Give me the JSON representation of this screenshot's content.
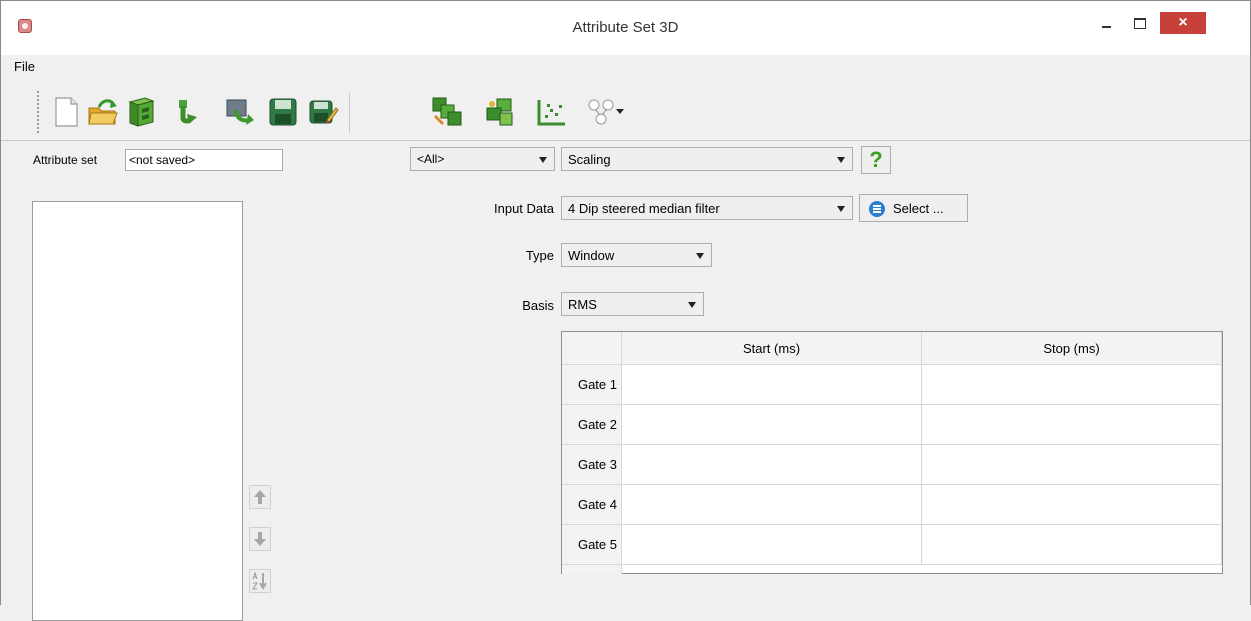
{
  "window": {
    "title": "Attribute Set 3D",
    "close_glyph": "×"
  },
  "menu": {
    "file": "File"
  },
  "toolbar": {
    "icons": [
      "new-icon",
      "open-icon",
      "database-icon",
      "import-icon",
      "reload-icon",
      "save-icon",
      "save-as-icon",
      "evaluate-icon",
      "crossplot-icon",
      "graph-icon",
      "tree-icon"
    ]
  },
  "attribute_set": {
    "label": "Attribute set",
    "value": "<not saved>"
  },
  "filter": {
    "category": "<All>",
    "attribute_type": "Scaling",
    "help": "?"
  },
  "form": {
    "input_data_label": "Input Data",
    "input_data_value": "4 Dip steered median filter",
    "select_button": "Select ...",
    "type_label": "Type",
    "type_value": "Window",
    "basis_label": "Basis",
    "basis_value": "RMS"
  },
  "gate_table": {
    "columns": [
      "Start (ms)",
      "Stop (ms)"
    ],
    "rows": [
      "Gate 1",
      "Gate 2",
      "Gate 3",
      "Gate 4",
      "Gate 5"
    ]
  },
  "colors": {
    "close_red": "#c7403a",
    "help_green": "#3f9e1f",
    "select_blue": "#2a7fd0"
  }
}
